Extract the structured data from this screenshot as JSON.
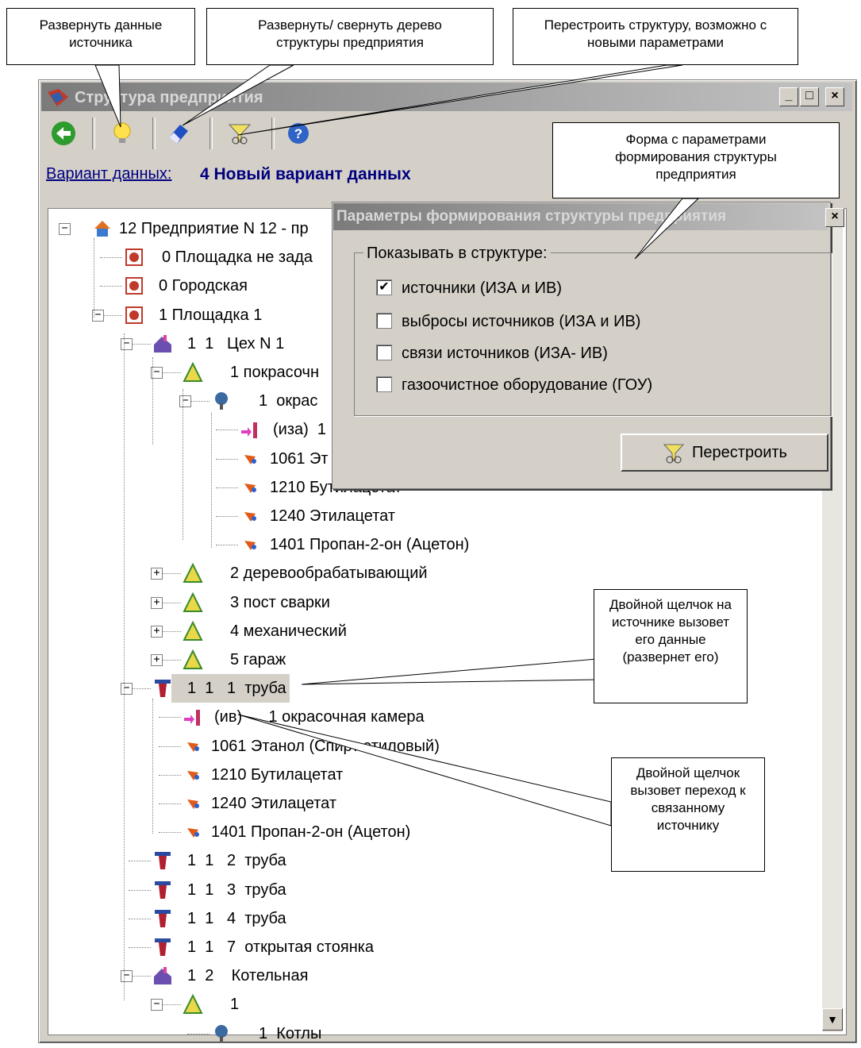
{
  "callouts": {
    "expand_source": "Развернуть данные источника",
    "toggle_tree": "Развернуть/ свернуть дерево структуры предприятия",
    "rebuild": "Перестроить структуру, возможно с новыми параметрами",
    "params_form": "Форма с параметрами формирования структуры предприятия",
    "double_click_source": "Двойной щелчок на источнике вызовет его данные (развернет его)",
    "double_click_link": "Двойной щелчок вызовет переход к связанному источнику"
  },
  "window": {
    "title": "Структура предприятия",
    "minimize": "_",
    "maximize": "□",
    "close": "×"
  },
  "variant": {
    "label": "Вариант данных:",
    "value": "4 Новый вариант данных"
  },
  "tree": [
    {
      "text": "12 Предприятие N 12 - пр",
      "icon": "house-icon"
    },
    {
      "text": "0 Площадка не зада",
      "icon": "site-icon"
    },
    {
      "text": "0 Городская",
      "icon": "site-icon"
    },
    {
      "text": "1 Площадка 1",
      "icon": "site-icon"
    },
    {
      "text": "1  1   Цех N 1",
      "icon": "workshop-icon"
    },
    {
      "text": "1 покрасочн",
      "icon": "section-icon"
    },
    {
      "text": "1  окрас",
      "icon": "equipment-icon"
    },
    {
      "text": "(иза)  1",
      "icon": "link-source-icon"
    },
    {
      "text": "1061 Эт",
      "icon": "substance-icon"
    },
    {
      "text": "1210 Бутилацетат",
      "icon": "substance-icon"
    },
    {
      "text": "1240 Этилацетат",
      "icon": "substance-icon"
    },
    {
      "text": "1401 Пропан-2-он (Ацетон)",
      "icon": "substance-icon"
    },
    {
      "text": "2 деревообрабатывающий",
      "icon": "section-icon"
    },
    {
      "text": "3 пост сварки",
      "icon": "section-icon"
    },
    {
      "text": "4 механический",
      "icon": "section-icon"
    },
    {
      "text": "5 гараж",
      "icon": "section-icon"
    },
    {
      "text": "1  1   1  труба",
      "icon": "pipe-icon"
    },
    {
      "text": "(ив)      1 окрасочная камера",
      "icon": "link-source-icon"
    },
    {
      "text": "1061 Этанол (Спирт этиловый)",
      "icon": "substance-icon"
    },
    {
      "text": "1210 Бутилацетат",
      "icon": "substance-icon"
    },
    {
      "text": "1240 Этилацетат",
      "icon": "substance-icon"
    },
    {
      "text": "1401 Пропан-2-он (Ацетон)",
      "icon": "substance-icon"
    },
    {
      "text": "1  1   2  труба",
      "icon": "pipe-icon"
    },
    {
      "text": "1  1   3  труба",
      "icon": "pipe-icon"
    },
    {
      "text": "1  1   4  труба",
      "icon": "pipe-icon"
    },
    {
      "text": "1  1   7  открытая стоянка",
      "icon": "pipe-icon"
    },
    {
      "text": "1  2    Котельная",
      "icon": "workshop-icon"
    },
    {
      "text": "1",
      "icon": "section-icon"
    },
    {
      "text": "1  Котлы",
      "icon": "equipment-icon"
    }
  ],
  "dialog": {
    "title": "Параметры формирования структуры предприятия",
    "close": "×",
    "group_label": "Показывать в структуре:",
    "options": [
      {
        "label": "источники (ИЗА и ИВ)",
        "checked": true
      },
      {
        "label": "выбросы источников (ИЗА и ИВ)",
        "checked": false
      },
      {
        "label": "связи источников (ИЗА- ИВ)",
        "checked": false
      },
      {
        "label": "газоочистное оборудование (ГОУ)",
        "checked": false
      }
    ],
    "rebuild_button": "Перестроить"
  },
  "colors": {
    "variant_text": "#000080",
    "window_face": "#d4d0c8",
    "selection": "#d4d0c8"
  }
}
